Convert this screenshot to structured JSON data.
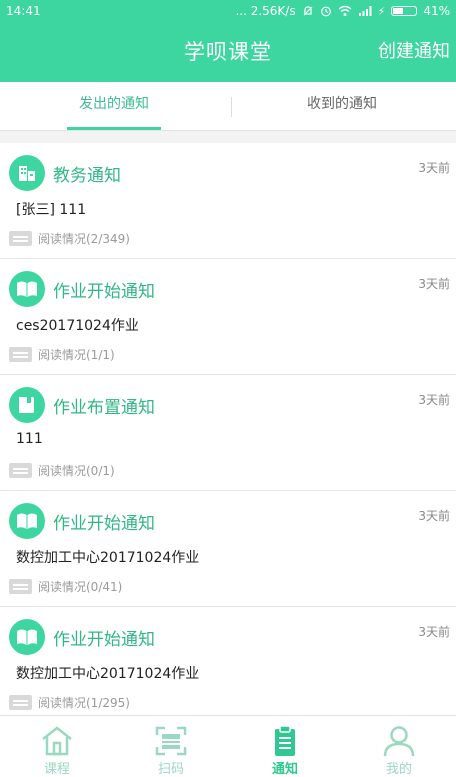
{
  "status": {
    "time": "14:41",
    "speed": "... 2.56K/s",
    "battery": "41%"
  },
  "header": {
    "title": "学呗课堂",
    "action": "创建通知"
  },
  "tabs": [
    {
      "label": "发出的通知",
      "active": true
    },
    {
      "label": "收到的通知",
      "active": false
    }
  ],
  "notices": [
    {
      "icon": "building-icon",
      "type": "教务通知",
      "time": "3天前",
      "content": "[张三] 111",
      "read": "阅读情况(2/349)"
    },
    {
      "icon": "open-book-icon",
      "type": "作业开始通知",
      "time": "3天前",
      "content": "ces20171024作业",
      "read": "阅读情况(1/1)"
    },
    {
      "icon": "notebook-icon",
      "type": "作业布置通知",
      "time": "3天前",
      "content": "111",
      "read": "阅读情况(0/1)"
    },
    {
      "icon": "open-book-icon",
      "type": "作业开始通知",
      "time": "3天前",
      "content": "数控加工中心20171024作业",
      "read": "阅读情况(0/41)"
    },
    {
      "icon": "open-book-icon",
      "type": "作业开始通知",
      "time": "3天前",
      "content": "数控加工中心20171024作业",
      "read": "阅读情况(1/295)"
    }
  ],
  "bottom_nav": [
    {
      "label": "课程",
      "icon": "home-icon",
      "active": false
    },
    {
      "label": "扫码",
      "icon": "scan-icon",
      "active": false
    },
    {
      "label": "通知",
      "icon": "clipboard-icon",
      "active": true
    },
    {
      "label": "我的",
      "icon": "person-icon",
      "active": false
    }
  ],
  "colors": {
    "brand": "#3dd6a0",
    "brand_text": "#2fb885",
    "inactive_nav": "#9bd8c0"
  }
}
